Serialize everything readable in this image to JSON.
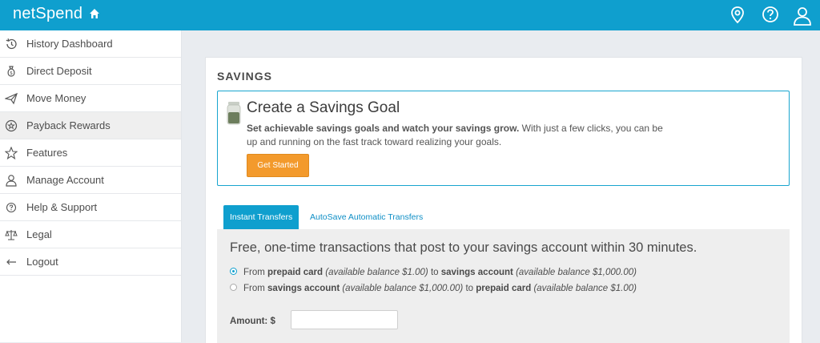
{
  "header": {
    "brand": "netSpend",
    "icons": [
      "home-icon",
      "location-pin-icon",
      "help-circle-icon",
      "user-icon"
    ]
  },
  "sidebar": {
    "items": [
      {
        "label": "History Dashboard",
        "icon": "history-icon"
      },
      {
        "label": "Direct Deposit",
        "icon": "money-bag-icon"
      },
      {
        "label": "Move Money",
        "icon": "paper-plane-icon"
      },
      {
        "label": "Payback Rewards",
        "icon": "rewards-badge-icon",
        "active": true
      },
      {
        "label": "Features",
        "icon": "star-icon"
      },
      {
        "label": "Manage Account",
        "icon": "person-icon"
      },
      {
        "label": "Help & Support",
        "icon": "help-icon"
      },
      {
        "label": "Legal",
        "icon": "scales-icon"
      },
      {
        "label": "Logout",
        "icon": "arrow-left-icon"
      }
    ]
  },
  "main": {
    "section_title": "SAVINGS",
    "goal": {
      "title": "Create a Savings Goal",
      "desc_bold": "Set achievable savings goals and watch your savings grow.",
      "desc_rest": " With just a few clicks, you can be up and running on the fast track toward realizing your goals.",
      "button": "Get Started"
    },
    "tabs": [
      {
        "label": "Instant Transfers",
        "active": true
      },
      {
        "label": "AutoSave Automatic Transfers",
        "active": false
      }
    ],
    "transfer": {
      "heading": "Free, one-time transactions that post to your savings account within 30 minutes.",
      "options": [
        {
          "selected": true,
          "from": "From ",
          "src": "prepaid card",
          "src_bal": " (available balance $1.00)",
          "to": " to ",
          "dst": "savings account",
          "dst_bal": " (available balance $1,000.00)"
        },
        {
          "selected": false,
          "from": "From ",
          "src": "savings account",
          "src_bal": " (available balance $1,000.00)",
          "to": " to ",
          "dst": "prepaid card",
          "dst_bal": " (available balance $1.00)"
        }
      ],
      "amount_label": "Amount: $",
      "amount_value": ""
    }
  }
}
